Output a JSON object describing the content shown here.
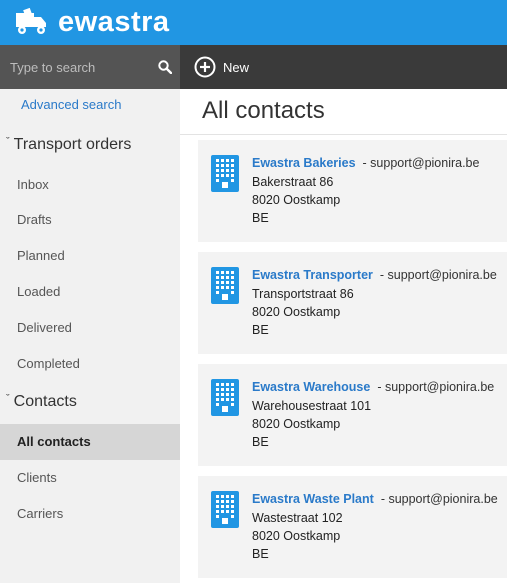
{
  "app": {
    "logo_text": "ewastra"
  },
  "search": {
    "placeholder": "Type to search",
    "advanced_label": "Advanced search"
  },
  "sidebar": {
    "sections": [
      {
        "label": "Transport orders",
        "items": [
          "Inbox",
          "Drafts",
          "Planned",
          "Loaded",
          "Delivered",
          "Completed"
        ]
      },
      {
        "label": "Contacts",
        "items": [
          "All contacts",
          "Clients",
          "Carriers"
        ]
      }
    ],
    "active_item": "All contacts"
  },
  "toolbar": {
    "new_label": "New"
  },
  "main": {
    "title": "All contacts"
  },
  "contacts": [
    {
      "name": "Ewastra Bakeries",
      "email": "- support@pionira.be",
      "street": "Bakerstraat 86",
      "city": "8020  Oostkamp",
      "country": "BE"
    },
    {
      "name": "Ewastra Transporter",
      "email": "- support@pionira.be",
      "street": "Transportstraat 86",
      "city": "8020  Oostkamp",
      "country": "BE"
    },
    {
      "name": "Ewastra Warehouse",
      "email": "- support@pionira.be",
      "street": "Warehousestraat 101",
      "city": "8020  Oostkamp",
      "country": "BE"
    },
    {
      "name": "Ewastra Waste Plant",
      "email": "- support@pionira.be",
      "street": "Wastestraat 102",
      "city": "8020  Oostkamp",
      "country": "BE"
    }
  ],
  "colors": {
    "header_blue": "#2196e3",
    "link_blue": "#2a7ac9",
    "toolbar_dark": "#3a3a3a",
    "search_dark": "#545454",
    "sidebar_bg": "#f1f1f1",
    "card_bg": "#f3f3f3",
    "active_bg": "#d6d6d6"
  },
  "icons": {
    "logo": "truck-logo-icon",
    "search": "search-icon",
    "new": "plus-circle-icon",
    "contact": "building-icon",
    "chevron": "chevron-down-icon"
  }
}
